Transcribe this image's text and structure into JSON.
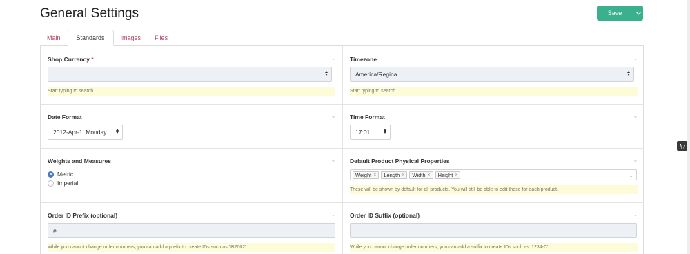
{
  "page": {
    "title": "General Settings"
  },
  "toolbar": {
    "save_label": "Save",
    "caret_icon": "chevron-down-icon"
  },
  "tabs": [
    {
      "label": "Main",
      "active": false
    },
    {
      "label": "Standards",
      "active": true
    },
    {
      "label": "Images",
      "active": false
    },
    {
      "label": "Files",
      "active": false
    }
  ],
  "fields": {
    "shop_currency": {
      "label": "Shop Currency",
      "required_mark": "*",
      "value": "",
      "help": "Start typing to search."
    },
    "timezone": {
      "label": "Timezone",
      "value": "America/Regina",
      "help": "Start typing to search."
    },
    "date_format": {
      "label": "Date Format",
      "value": "2012-Apr-1, Monday"
    },
    "time_format": {
      "label": "Time Format",
      "value": "17:01"
    },
    "weights_measures": {
      "label": "Weights and Measures",
      "options": [
        {
          "label": "Metric",
          "checked": true
        },
        {
          "label": "Imperial",
          "checked": false
        }
      ]
    },
    "physical_properties": {
      "label": "Default Product Physical Properties",
      "tags": [
        "Weight",
        "Length",
        "Width",
        "Height"
      ],
      "remove_glyph": "×",
      "help": "These will be shown by default for all products. You will still be able to edit these for each product."
    },
    "order_prefix": {
      "label": "Order ID Prefix (optional)",
      "value": "#",
      "help": "While you cannot change order numbers, you can add a prefix to create IDs such as 'IB2002'."
    },
    "order_suffix": {
      "label": "Order ID Suffix (optional)",
      "value": "",
      "help": "While you cannot change order numbers, you can add a suffix to create IDs such as '1234-C'."
    }
  },
  "side": {
    "cart_icon": "shopping-cart-icon"
  },
  "colors": {
    "accent": "#3bb08f",
    "tab_link": "#b3445b",
    "required": "#d93c3c",
    "help_bg": "#fdfbd8"
  }
}
